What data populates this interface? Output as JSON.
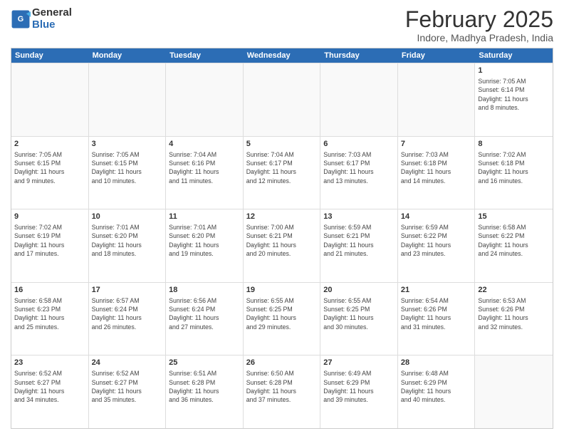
{
  "logo": {
    "general": "General",
    "blue": "Blue"
  },
  "title": "February 2025",
  "subtitle": "Indore, Madhya Pradesh, India",
  "days": [
    "Sunday",
    "Monday",
    "Tuesday",
    "Wednesday",
    "Thursday",
    "Friday",
    "Saturday"
  ],
  "rows": [
    [
      {
        "day": "",
        "info": ""
      },
      {
        "day": "",
        "info": ""
      },
      {
        "day": "",
        "info": ""
      },
      {
        "day": "",
        "info": ""
      },
      {
        "day": "",
        "info": ""
      },
      {
        "day": "",
        "info": ""
      },
      {
        "day": "1",
        "info": "Sunrise: 7:05 AM\nSunset: 6:14 PM\nDaylight: 11 hours\nand 8 minutes."
      }
    ],
    [
      {
        "day": "2",
        "info": "Sunrise: 7:05 AM\nSunset: 6:15 PM\nDaylight: 11 hours\nand 9 minutes."
      },
      {
        "day": "3",
        "info": "Sunrise: 7:05 AM\nSunset: 6:15 PM\nDaylight: 11 hours\nand 10 minutes."
      },
      {
        "day": "4",
        "info": "Sunrise: 7:04 AM\nSunset: 6:16 PM\nDaylight: 11 hours\nand 11 minutes."
      },
      {
        "day": "5",
        "info": "Sunrise: 7:04 AM\nSunset: 6:17 PM\nDaylight: 11 hours\nand 12 minutes."
      },
      {
        "day": "6",
        "info": "Sunrise: 7:03 AM\nSunset: 6:17 PM\nDaylight: 11 hours\nand 13 minutes."
      },
      {
        "day": "7",
        "info": "Sunrise: 7:03 AM\nSunset: 6:18 PM\nDaylight: 11 hours\nand 14 minutes."
      },
      {
        "day": "8",
        "info": "Sunrise: 7:02 AM\nSunset: 6:18 PM\nDaylight: 11 hours\nand 16 minutes."
      }
    ],
    [
      {
        "day": "9",
        "info": "Sunrise: 7:02 AM\nSunset: 6:19 PM\nDaylight: 11 hours\nand 17 minutes."
      },
      {
        "day": "10",
        "info": "Sunrise: 7:01 AM\nSunset: 6:20 PM\nDaylight: 11 hours\nand 18 minutes."
      },
      {
        "day": "11",
        "info": "Sunrise: 7:01 AM\nSunset: 6:20 PM\nDaylight: 11 hours\nand 19 minutes."
      },
      {
        "day": "12",
        "info": "Sunrise: 7:00 AM\nSunset: 6:21 PM\nDaylight: 11 hours\nand 20 minutes."
      },
      {
        "day": "13",
        "info": "Sunrise: 6:59 AM\nSunset: 6:21 PM\nDaylight: 11 hours\nand 21 minutes."
      },
      {
        "day": "14",
        "info": "Sunrise: 6:59 AM\nSunset: 6:22 PM\nDaylight: 11 hours\nand 23 minutes."
      },
      {
        "day": "15",
        "info": "Sunrise: 6:58 AM\nSunset: 6:22 PM\nDaylight: 11 hours\nand 24 minutes."
      }
    ],
    [
      {
        "day": "16",
        "info": "Sunrise: 6:58 AM\nSunset: 6:23 PM\nDaylight: 11 hours\nand 25 minutes."
      },
      {
        "day": "17",
        "info": "Sunrise: 6:57 AM\nSunset: 6:24 PM\nDaylight: 11 hours\nand 26 minutes."
      },
      {
        "day": "18",
        "info": "Sunrise: 6:56 AM\nSunset: 6:24 PM\nDaylight: 11 hours\nand 27 minutes."
      },
      {
        "day": "19",
        "info": "Sunrise: 6:55 AM\nSunset: 6:25 PM\nDaylight: 11 hours\nand 29 minutes."
      },
      {
        "day": "20",
        "info": "Sunrise: 6:55 AM\nSunset: 6:25 PM\nDaylight: 11 hours\nand 30 minutes."
      },
      {
        "day": "21",
        "info": "Sunrise: 6:54 AM\nSunset: 6:26 PM\nDaylight: 11 hours\nand 31 minutes."
      },
      {
        "day": "22",
        "info": "Sunrise: 6:53 AM\nSunset: 6:26 PM\nDaylight: 11 hours\nand 32 minutes."
      }
    ],
    [
      {
        "day": "23",
        "info": "Sunrise: 6:52 AM\nSunset: 6:27 PM\nDaylight: 11 hours\nand 34 minutes."
      },
      {
        "day": "24",
        "info": "Sunrise: 6:52 AM\nSunset: 6:27 PM\nDaylight: 11 hours\nand 35 minutes."
      },
      {
        "day": "25",
        "info": "Sunrise: 6:51 AM\nSunset: 6:28 PM\nDaylight: 11 hours\nand 36 minutes."
      },
      {
        "day": "26",
        "info": "Sunrise: 6:50 AM\nSunset: 6:28 PM\nDaylight: 11 hours\nand 37 minutes."
      },
      {
        "day": "27",
        "info": "Sunrise: 6:49 AM\nSunset: 6:29 PM\nDaylight: 11 hours\nand 39 minutes."
      },
      {
        "day": "28",
        "info": "Sunrise: 6:48 AM\nSunset: 6:29 PM\nDaylight: 11 hours\nand 40 minutes."
      },
      {
        "day": "",
        "info": ""
      }
    ]
  ]
}
